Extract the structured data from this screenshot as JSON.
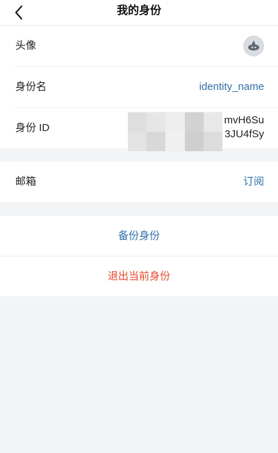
{
  "header": {
    "title": "我的身份"
  },
  "profile": {
    "avatar_label": "头像",
    "name_label": "身份名",
    "name_value": "identity_name",
    "id_label": "身份 ID",
    "id_line1": "mvH6Su",
    "id_line2": "3JU4fSy"
  },
  "mail": {
    "label": "邮箱",
    "action": "订阅"
  },
  "actions": {
    "backup": "备份身份",
    "logout": "退出当前身份"
  },
  "colors": {
    "link": "#2f6fa8",
    "danger": "#e2492f",
    "background": "#f3f4f6"
  }
}
